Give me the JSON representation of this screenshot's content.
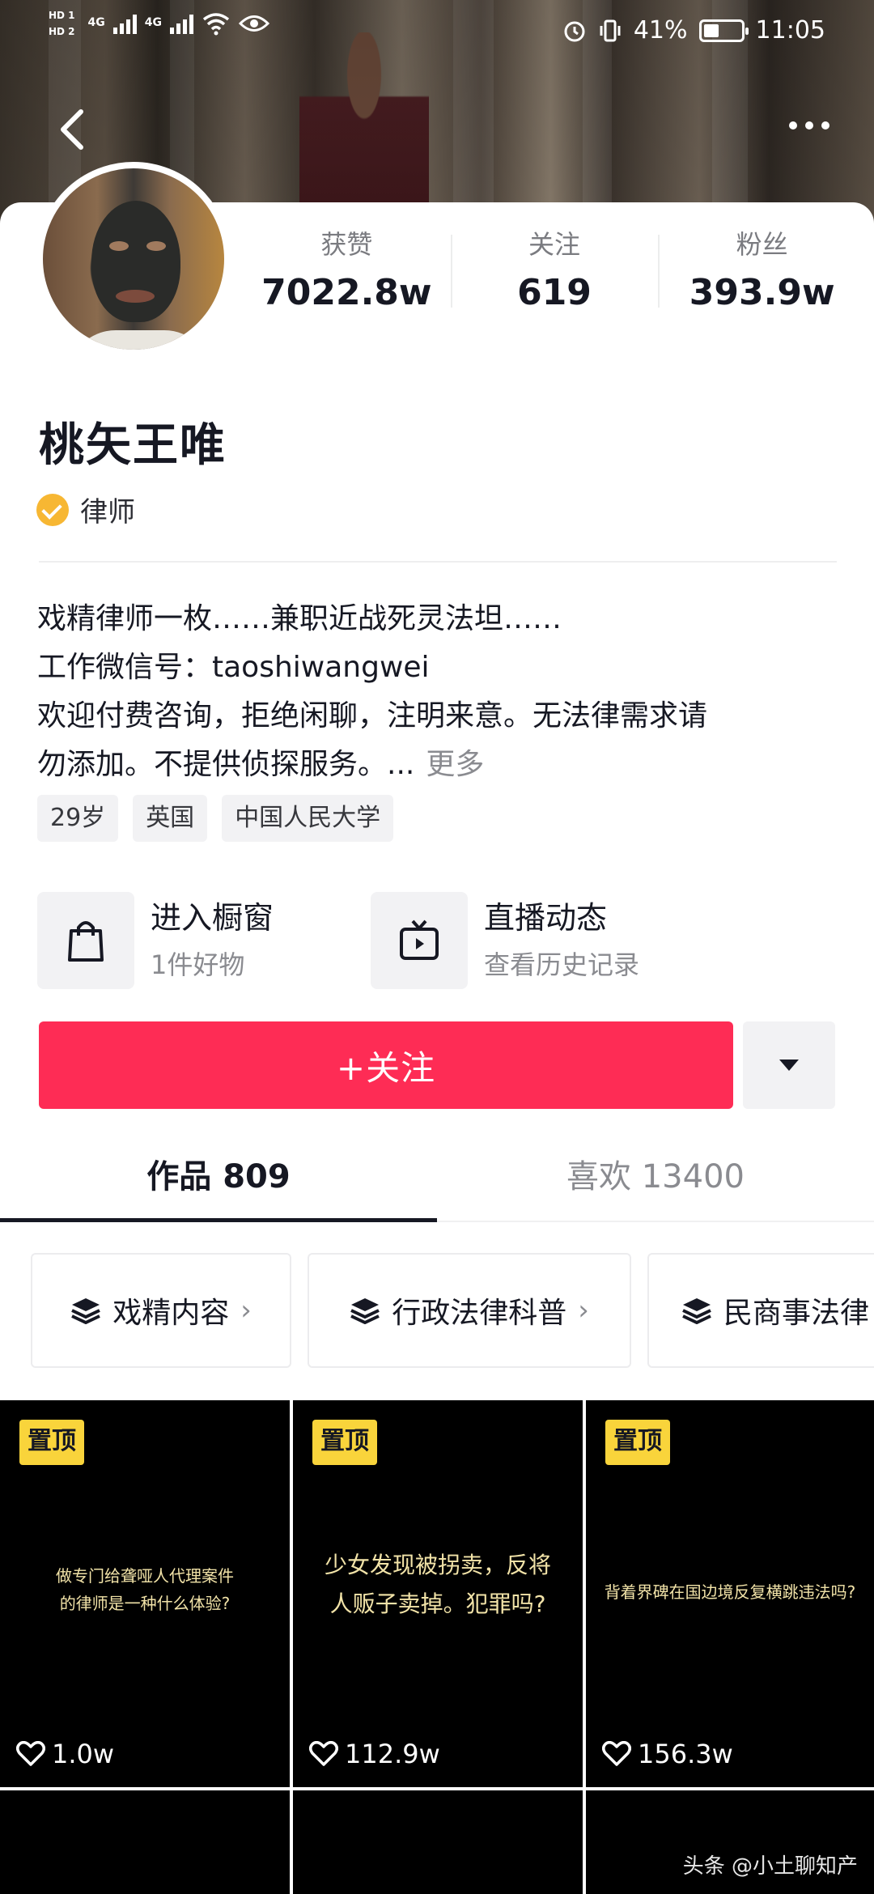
{
  "status_bar": {
    "hd1": "HD 1",
    "hd2": "HD 2",
    "net1": "4G",
    "net2": "4G",
    "battery_pct": "41%",
    "battery_level": 0.41,
    "time": "11:05"
  },
  "profile": {
    "name": "桃矢王唯",
    "verified_label": "律师",
    "stats": [
      {
        "label": "获赞",
        "value": "7022.8w"
      },
      {
        "label": "关注",
        "value": "619"
      },
      {
        "label": "粉丝",
        "value": "393.9w"
      }
    ],
    "bio_lines": [
      "戏精律师一枚……兼职近战死灵法坦……",
      "工作微信号：taoshiwangwei",
      "欢迎付费咨询，拒绝闲聊，注明来意。无法律需求请",
      "勿添加。不提供侦探服务。..."
    ],
    "bio_more": "更多",
    "tags": [
      "29岁",
      "英国",
      "中国人民大学"
    ]
  },
  "services": [
    {
      "title": "进入橱窗",
      "subtitle": "1件好物",
      "icon": "shopping-bag-icon"
    },
    {
      "title": "直播动态",
      "subtitle": "查看历史记录",
      "icon": "live-tv-icon"
    }
  ],
  "actions": {
    "follow_label": "+关注"
  },
  "tabs": [
    {
      "label": "作品 809",
      "active": true
    },
    {
      "label": "喜欢 13400",
      "active": false
    }
  ],
  "collections": [
    {
      "label": "戏精内容"
    },
    {
      "label": "行政法律科普"
    },
    {
      "label": "民商事法律"
    }
  ],
  "videos": [
    {
      "pin": "置顶",
      "text_lines": [
        "做专门给聋哑人代理案件",
        "的律师是一种什么体验?"
      ],
      "likes": "1.0w"
    },
    {
      "pin": "置顶",
      "text_lines": [
        "少女发现被拐卖，反将",
        "人贩子卖掉。犯罪吗?"
      ],
      "likes": "112.9w"
    },
    {
      "pin": "置顶",
      "text_lines": [
        "背着界碑在国边境反复横跳违法吗?"
      ],
      "likes": "156.3w"
    }
  ],
  "watermark": "头条 @小土聊知产"
}
